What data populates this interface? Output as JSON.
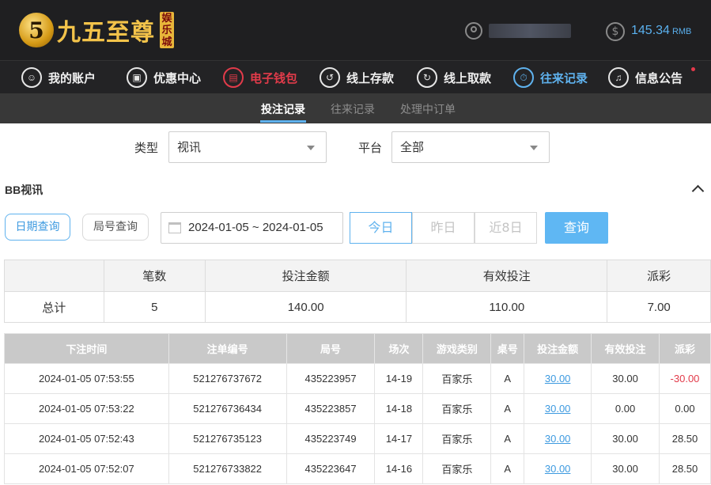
{
  "header": {
    "logo_text": "九五至尊",
    "logo_tag": "娱乐城",
    "balance": "145.34",
    "balance_unit": "RMB"
  },
  "nav": [
    {
      "label": "我的账户",
      "icon": "user-icon"
    },
    {
      "label": "优惠中心",
      "icon": "gift-icon"
    },
    {
      "label": "电子钱包",
      "icon": "wallet-icon"
    },
    {
      "label": "线上存款",
      "icon": "deposit-icon"
    },
    {
      "label": "线上取款",
      "icon": "withdraw-icon"
    },
    {
      "label": "往来记录",
      "icon": "records-icon"
    },
    {
      "label": "信息公告",
      "icon": "bell-icon"
    }
  ],
  "subnav": {
    "tabs": [
      "投注记录",
      "往来记录",
      "处理中订单"
    ],
    "active": "投注记录"
  },
  "filters": {
    "type_label": "类型",
    "type_value": "视讯",
    "platform_label": "平台",
    "platform_value": "全部"
  },
  "section": {
    "title": "BB视讯"
  },
  "query": {
    "mode_date": "日期查询",
    "mode_round": "局号查询",
    "date_range": "2024-01-05 ~ 2024-01-05",
    "quick": [
      "今日",
      "昨日",
      "近8日"
    ],
    "active_quick": "今日",
    "submit": "查询"
  },
  "summary": {
    "headers": [
      "",
      "笔数",
      "投注金额",
      "有效投注",
      "派彩"
    ],
    "row": [
      "总计",
      "5",
      "140.00",
      "110.00",
      "7.00"
    ]
  },
  "detail": {
    "headers": [
      "下注时间",
      "注单编号",
      "局号",
      "场次",
      "游戏类别",
      "桌号",
      "投注金额",
      "有效投注",
      "派彩"
    ],
    "rows": [
      [
        "2024-01-05 07:53:55",
        "521276737672",
        "435223957",
        "14-19",
        "百家乐",
        "A",
        "30.00",
        "30.00",
        "-30.00"
      ],
      [
        "2024-01-05 07:53:22",
        "521276736434",
        "435223857",
        "14-18",
        "百家乐",
        "A",
        "30.00",
        "0.00",
        "0.00"
      ],
      [
        "2024-01-05 07:52:43",
        "521276735123",
        "435223749",
        "14-17",
        "百家乐",
        "A",
        "30.00",
        "30.00",
        "28.50"
      ],
      [
        "2024-01-05 07:52:07",
        "521276733822",
        "435223647",
        "14-16",
        "百家乐",
        "A",
        "30.00",
        "30.00",
        "28.50"
      ]
    ]
  },
  "colors": {
    "accent": "#5fb2ee",
    "danger": "#e23b4a",
    "header_bg": "#1f1f21"
  }
}
